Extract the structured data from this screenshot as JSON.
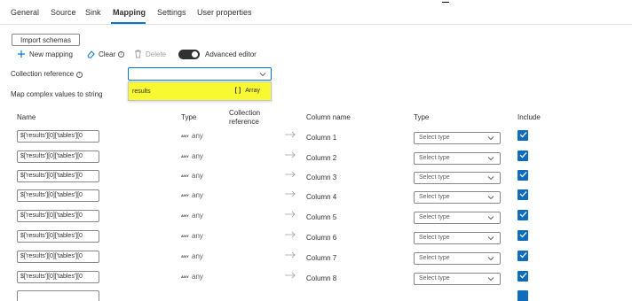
{
  "tabs": [
    {
      "label": "General"
    },
    {
      "label": "Source"
    },
    {
      "label": "Sink"
    },
    {
      "label": "Mapping"
    },
    {
      "label": "Settings"
    },
    {
      "label": "User properties"
    }
  ],
  "active_tab": "Mapping",
  "import_schemas_label": "Import schemas",
  "toolbar": {
    "new_mapping_label": "New mapping",
    "clear_label": "Clear",
    "delete_label": "Delete",
    "advanced_editor_label": "Advanced editor",
    "advanced_editor_on": true
  },
  "collection_reference": {
    "label": "Collection reference",
    "value": "",
    "options": [
      {
        "label": "results",
        "type_icon": "[ ]",
        "type": "Array"
      }
    ]
  },
  "map_complex_label": "Map complex values to string",
  "table": {
    "headers": {
      "name": "Name",
      "type": "Type",
      "collection_reference": "Collection reference",
      "column_name": "Column name",
      "dest_type": "Type",
      "include": "Include"
    },
    "rows": [
      {
        "name": "$['results'][0]['tables'][0",
        "type_tag": "ANY",
        "type": "any",
        "column": "Column 1",
        "dest_type_placeholder": "Select type",
        "include": true
      },
      {
        "name": "$['results'][0]['tables'][0",
        "type_tag": "ANY",
        "type": "any",
        "column": "Column 2",
        "dest_type_placeholder": "Select type",
        "include": true
      },
      {
        "name": "$['results'][0]['tables'][0",
        "type_tag": "ANY",
        "type": "any",
        "column": "Column 3",
        "dest_type_placeholder": "Select type",
        "include": true
      },
      {
        "name": "$['results'][0]['tables'][0",
        "type_tag": "ANY",
        "type": "any",
        "column": "Column 4",
        "dest_type_placeholder": "Select type",
        "include": true
      },
      {
        "name": "$['results'][0]['tables'][0",
        "type_tag": "ANY",
        "type": "any",
        "column": "Column 5",
        "dest_type_placeholder": "Select type",
        "include": true
      },
      {
        "name": "$['results'][0]['tables'][0",
        "type_tag": "ANY",
        "type": "any",
        "column": "Column 6",
        "dest_type_placeholder": "Select type",
        "include": true
      },
      {
        "name": "$['results'][0]['tables'][0",
        "type_tag": "ANY",
        "type": "any",
        "column": "Column 7",
        "dest_type_placeholder": "Select type",
        "include": true
      },
      {
        "name": "$['results'][0]['tables'][0",
        "type_tag": "ANY",
        "type": "any",
        "column": "Column 8",
        "dest_type_placeholder": "Select type",
        "include": true
      }
    ]
  },
  "colors": {
    "accent": "#0078d4",
    "checkbox": "#0f6cbd",
    "highlight": "#f8f930"
  },
  "icons": {
    "new_mapping": "plus-icon",
    "clear": "eraser-icon",
    "delete": "trash-icon",
    "info": "info-icon",
    "chevron": "chevron-down-icon",
    "arrow": "arrow-right-icon",
    "check": "checkmark-icon"
  }
}
